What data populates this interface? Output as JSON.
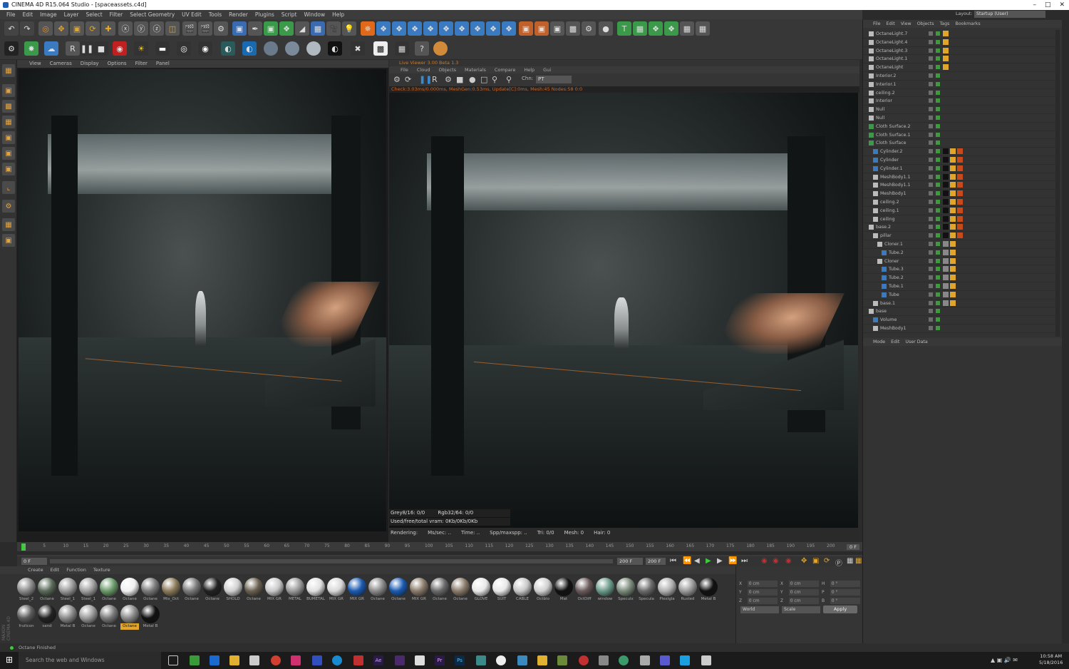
{
  "window": {
    "title": "CINEMA 4D R15.064 Studio - [spaceassets.c4d]"
  },
  "menubar": [
    "File",
    "Edit",
    "Image",
    "Layer",
    "Select",
    "Filter",
    "Select Geometry",
    "UV Edit",
    "Tools",
    "Render",
    "Plugins",
    "Script",
    "Window",
    "Help"
  ],
  "viewport": {
    "menu": [
      "View",
      "Cameras",
      "Display",
      "Options",
      "Filter",
      "Panel"
    ]
  },
  "liveviewer": {
    "title": "Live Viewer 3.00 Beta 1.3",
    "menu": [
      "File",
      "Cloud",
      "Objects",
      "Materials",
      "Compare",
      "Help",
      "Gui"
    ],
    "channel_label": "Chn:",
    "channel_value": "PT",
    "status": "Check:3.03ms/0.000ms, MeshGen:0.53ms, Update[C]:0ms, Mesh:45 Nodes:58 0:0",
    "info_row1_a": "Grey8/16: 0/0",
    "info_row1_b": "Rgb32/64: 0/0",
    "info_row2": "Used/free/total vram: 0Kb/0Kb/0Kb",
    "render_status": [
      "Rendering:",
      "Ms/sec: ..",
      "Time: ..",
      "Spp/maxspp: ..",
      "Tri: 0/0",
      "Mesh: 0",
      "Hair: 0"
    ]
  },
  "timeline": {
    "ticks": [
      "0",
      "5",
      "10",
      "15",
      "20",
      "25",
      "30",
      "35",
      "40",
      "45",
      "50",
      "55",
      "60",
      "65",
      "70",
      "75",
      "80",
      "85",
      "90",
      "95",
      "100",
      "105",
      "110",
      "115",
      "120",
      "125",
      "130",
      "135",
      "140",
      "145",
      "150",
      "155",
      "160",
      "165",
      "170",
      "175",
      "180",
      "185",
      "190",
      "195",
      "200"
    ],
    "current_frame": "0 F",
    "start_field": "0 F",
    "end_field": "200 F",
    "end_field2": "200 F"
  },
  "material_manager": {
    "menu": [
      "Create",
      "Edit",
      "Function",
      "Texture"
    ],
    "row1": [
      "Steel_2",
      "Octane",
      "Steel_1",
      "Steel_1",
      "Octane",
      "Octane",
      "Octane",
      "Mix_Oct",
      "Octane",
      "Octane",
      "SHOLD",
      "Octane",
      "MIX GR",
      "METAL",
      "BUMETAL",
      "MIX GR",
      "MIX GR",
      "Octane",
      "Octane",
      "MIX GR",
      "Octane",
      "Octane",
      "GLOVE",
      "SUIT",
      "CABLE",
      "Octblo",
      "Mat",
      "OctDiff",
      "window",
      "Speculx",
      "Specula",
      "Plexigla",
      "Rusted",
      "Metal B"
    ],
    "row2": [
      "fruitcon",
      "sand",
      "Metal B",
      "Octane",
      "Octane",
      "Octane",
      "Metal B"
    ],
    "selected": "Octane"
  },
  "coords": {
    "rows": [
      {
        "a": "X",
        "av": "0 cm",
        "b": "X",
        "bv": "0 cm",
        "c": "H",
        "cv": "0 °"
      },
      {
        "a": "Y",
        "av": "0 cm",
        "b": "Y",
        "bv": "0 cm",
        "c": "P",
        "cv": "0 °"
      },
      {
        "a": "Z",
        "av": "0 cm",
        "b": "Z",
        "bv": "0 cm",
        "c": "B",
        "cv": "0 °"
      }
    ],
    "world": "World",
    "size": "Scale",
    "apply": "Apply"
  },
  "object_manager": {
    "menu": [
      "File",
      "Edit",
      "View",
      "Objects",
      "Tags",
      "Bookmarks"
    ],
    "layout_label": "Layout:",
    "layout_value": "Startup (User)",
    "objects": [
      "OctaneLight.7",
      "OctaneLight.4",
      "OctaneLight.3",
      "OctaneLight.1",
      "OctaneLight",
      "Interior.2",
      "Interior.1",
      "ceiling.2",
      "Interior",
      "Null",
      "Null",
      "Cloth Surface.2",
      "Cloth Surface.1",
      "Cloth Surface",
      "Cylinder.2",
      "Cylinder",
      "Cylinder.1",
      "MeshBody1.1",
      "MeshBody1.1",
      "MeshBody1",
      "ceiling.2",
      "ceiling.1",
      "ceiling",
      "base.2",
      "pillar",
      "Cloner.1",
      "Tube.2",
      "Cloner",
      "Tube.3",
      "Tube.2",
      "Tube.1",
      "Tube",
      "base.1",
      "base",
      "Volume",
      "MeshBody1"
    ]
  },
  "attributes": {
    "menu": [
      "Mode",
      "Edit",
      "User Data"
    ]
  },
  "statusbar": {
    "text": "Octane Finished"
  },
  "taskbar": {
    "search": "Search the web and Windows",
    "time": "10:58 AM",
    "date": "5/18/2016"
  }
}
